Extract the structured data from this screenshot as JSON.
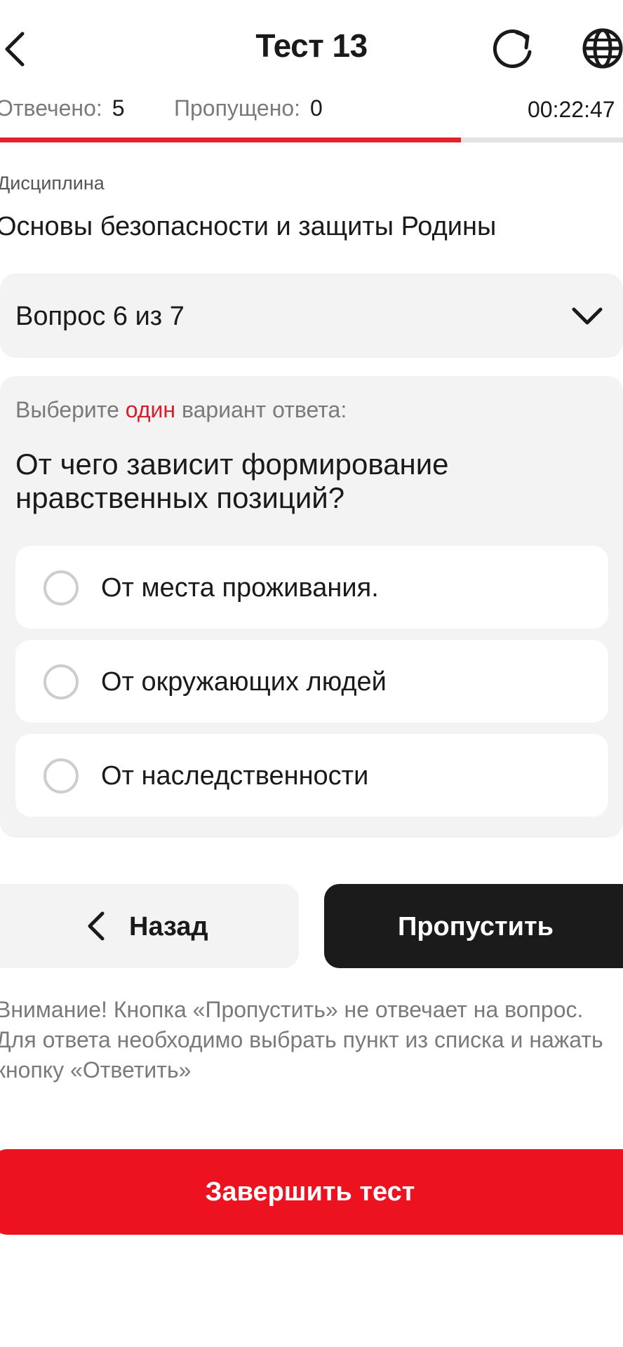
{
  "header": {
    "title": "Тест 13",
    "back_icon": "chevron-left-icon",
    "refresh_icon": "refresh-icon",
    "language_icon": "globe-icon"
  },
  "stats": {
    "answered_label": "Отвечено:",
    "answered_value": "5",
    "skipped_label": "Пропущено:",
    "skipped_value": "0",
    "timer": "00:22:47"
  },
  "progress": {
    "fraction": 0.74
  },
  "discipline": {
    "label": "Дисциплина",
    "name": "Основы безопасности и защиты Родины"
  },
  "question_selector": {
    "text": "Вопрос 6 из 7"
  },
  "question": {
    "instruction_before": "Выберите ",
    "instruction_highlight": "один",
    "instruction_after": " вариант ответа:",
    "text": "От чего зависит формирование нравственных позиций?",
    "options": [
      {
        "label": "От места проживания."
      },
      {
        "label": "От окружающих людей"
      },
      {
        "label": "От наследственности"
      }
    ]
  },
  "buttons": {
    "back_label": "Назад",
    "skip_label": "Пропустить",
    "finish_label": "Завершить тест"
  },
  "notice": "Внимание! Кнопка «Пропустить» не отвечает на вопрос. Для ответа необходимо выбрать пункт из списка и нажать кнопку «Ответить»",
  "colors": {
    "accent_red": "#ec1220",
    "highlight_red": "#d4202b",
    "dark_button": "#1b1b1b",
    "card_bg": "#f3f3f3"
  }
}
